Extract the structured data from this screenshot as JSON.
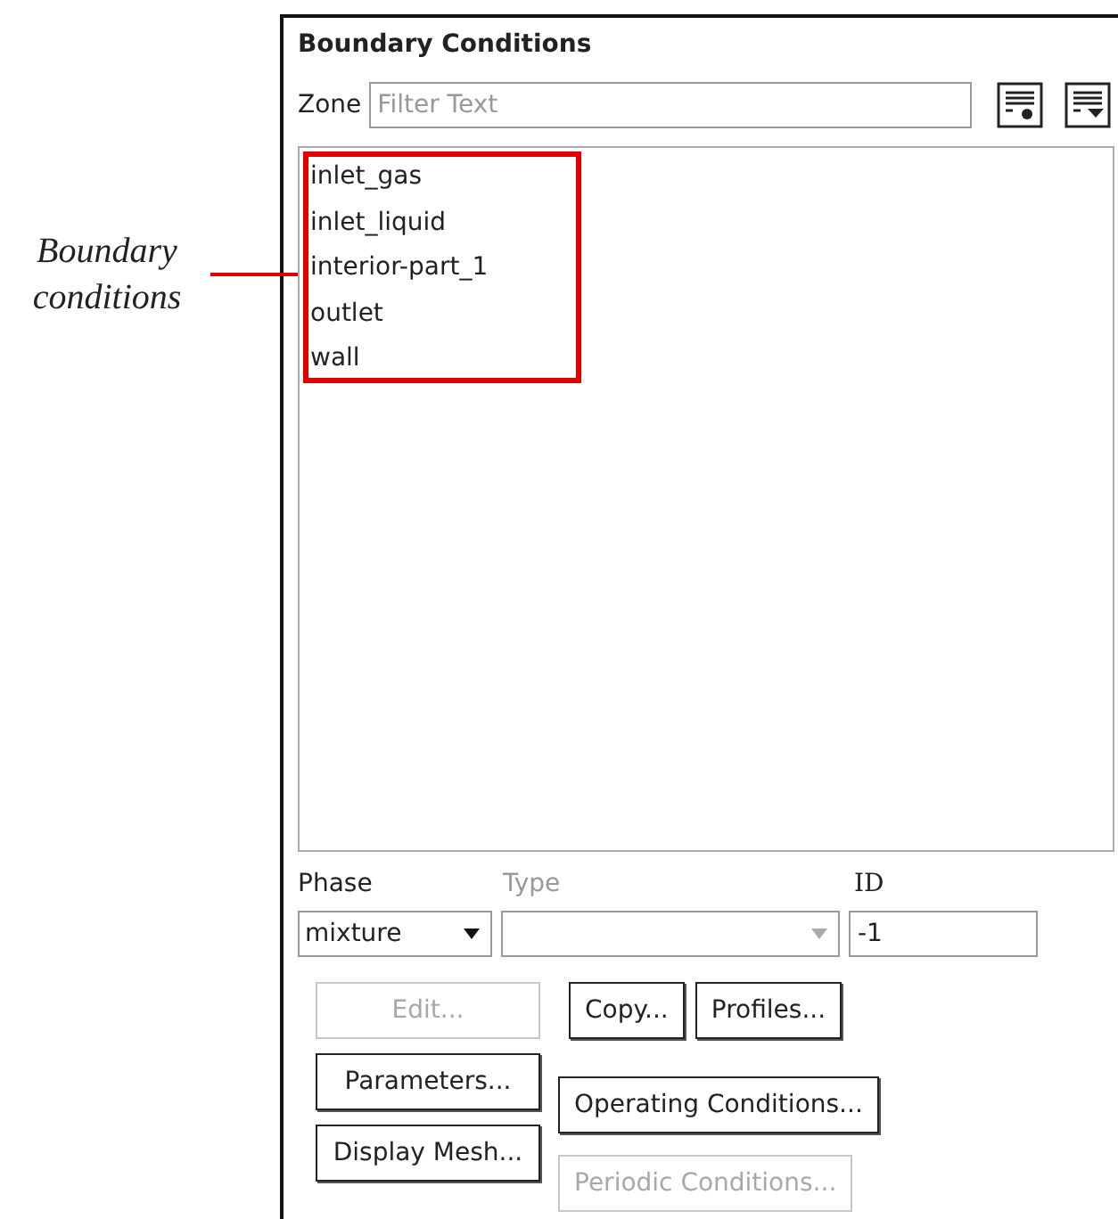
{
  "annotation": {
    "text": "Boundary conditions"
  },
  "panel": {
    "title": "Boundary Conditions",
    "filter": {
      "label": "Zone",
      "placeholder": "Filter Text"
    },
    "zones": [
      {
        "name": "inlet_gas",
        "selected": false
      },
      {
        "name": "inlet_liquid",
        "selected": false
      },
      {
        "name": "interior-part_1",
        "selected": false
      },
      {
        "name": "outlet",
        "selected": false
      },
      {
        "name": "wall",
        "selected": false
      }
    ],
    "phase": {
      "label": "Phase",
      "value": "mixture",
      "disabled": false
    },
    "type": {
      "label": "Type",
      "disabled": true
    },
    "id": {
      "label": "ID",
      "value": "-1"
    },
    "buttons": [
      {
        "label": "Edit...",
        "disabled": true
      },
      {
        "label": "Copy...",
        "disabled": false
      },
      {
        "label": "Profiles...",
        "disabled": false
      },
      {
        "label": "Parameters...",
        "disabled": false
      },
      {
        "label": "Operating Conditions...",
        "disabled": false
      },
      {
        "label": "Display Mesh...",
        "disabled": false
      },
      {
        "label": "Periodic Conditions...",
        "disabled": true
      }
    ]
  }
}
